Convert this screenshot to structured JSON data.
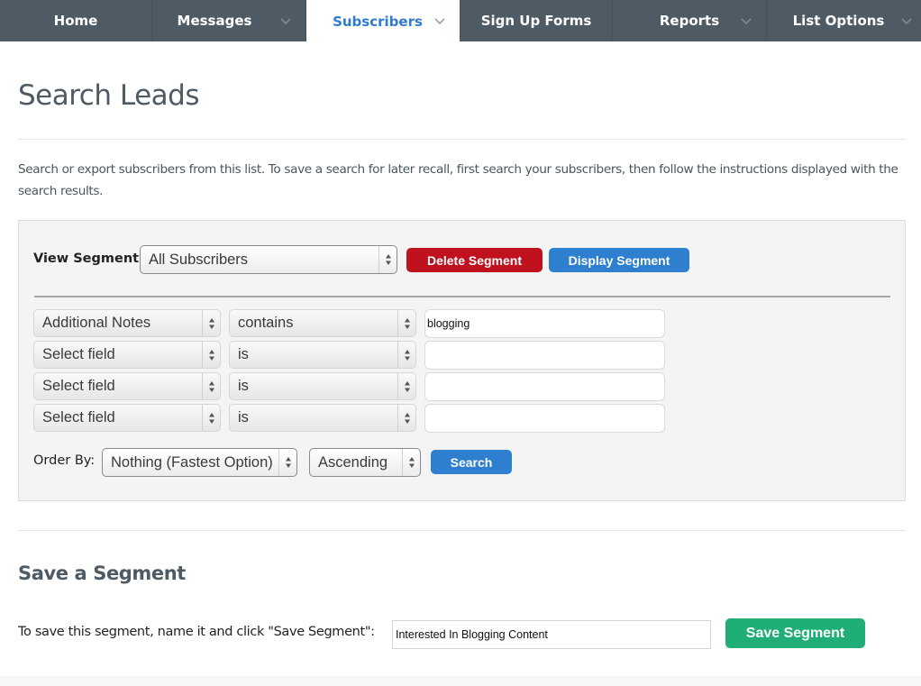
{
  "nav": {
    "items": [
      {
        "label": "Home",
        "has_dropdown": false,
        "active": false
      },
      {
        "label": "Messages",
        "has_dropdown": true,
        "active": false
      },
      {
        "label": "Subscribers",
        "has_dropdown": true,
        "active": true
      },
      {
        "label": "Sign Up Forms",
        "has_dropdown": false,
        "active": false
      },
      {
        "label": "Reports",
        "has_dropdown": true,
        "active": false
      },
      {
        "label": "List Options",
        "has_dropdown": true,
        "active": false
      }
    ]
  },
  "page": {
    "title": "Search Leads",
    "intro": "Search or export subscribers from this list. To save a search for later recall, first search your subscribers, then follow the instructions displayed with the search results."
  },
  "segment": {
    "view_label": "View Segment:",
    "selected": "All Subscribers",
    "delete_label": "Delete Segment",
    "display_label": "Display Segment"
  },
  "criteria": [
    {
      "field": "Additional Notes",
      "operator": "contains",
      "value": "blogging"
    },
    {
      "field": "Select field",
      "operator": "is",
      "value": ""
    },
    {
      "field": "Select field",
      "operator": "is",
      "value": ""
    },
    {
      "field": "Select field",
      "operator": "is",
      "value": ""
    }
  ],
  "order": {
    "label": "Order By:",
    "field": "Nothing (Fastest Option)",
    "direction": "Ascending",
    "search_label": "Search"
  },
  "save": {
    "title": "Save a Segment",
    "instruction": "To save this segment, name it and click \"Save Segment\":",
    "name_value": "Interested In Blogging Content",
    "button_label": "Save Segment"
  },
  "colors": {
    "nav_bg": "#4f5b64",
    "active_tab_text": "#2e7bcf",
    "delete_button": "#c0111f",
    "primary_button": "#2f7fd1",
    "save_button": "#1fae76"
  }
}
